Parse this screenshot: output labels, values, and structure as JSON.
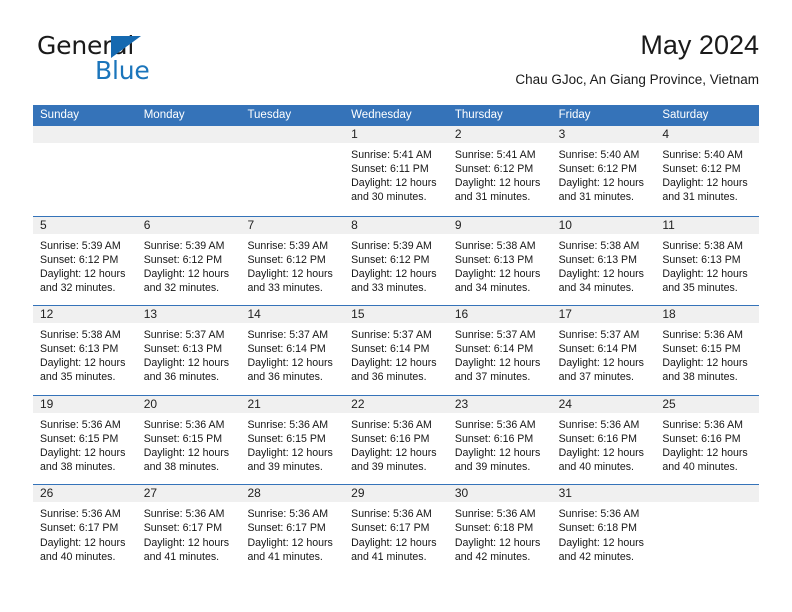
{
  "brand": {
    "name_top": "General",
    "name_bottom": "Blue",
    "accent_color": "#1b75bb",
    "triangle_color": "#1569b0"
  },
  "header": {
    "title": "May 2024",
    "subtitle": "Chau GJoc, An Giang Province, Vietnam"
  },
  "theme": {
    "header_band": "#3573b9",
    "day_band": "#f0f0f0",
    "text": "#161616"
  },
  "calendar": {
    "weekdays": [
      "Sunday",
      "Monday",
      "Tuesday",
      "Wednesday",
      "Thursday",
      "Friday",
      "Saturday"
    ],
    "weeks": [
      [
        {
          "day": "",
          "sunrise": "",
          "sunset": "",
          "daylight_line1": "",
          "daylight_line2": "",
          "empty": true
        },
        {
          "day": "",
          "sunrise": "",
          "sunset": "",
          "daylight_line1": "",
          "daylight_line2": "",
          "empty": true
        },
        {
          "day": "",
          "sunrise": "",
          "sunset": "",
          "daylight_line1": "",
          "daylight_line2": "",
          "empty": true
        },
        {
          "day": "1",
          "sunrise": "Sunrise: 5:41 AM",
          "sunset": "Sunset: 6:11 PM",
          "daylight_line1": "Daylight: 12 hours",
          "daylight_line2": "and 30 minutes."
        },
        {
          "day": "2",
          "sunrise": "Sunrise: 5:41 AM",
          "sunset": "Sunset: 6:12 PM",
          "daylight_line1": "Daylight: 12 hours",
          "daylight_line2": "and 31 minutes."
        },
        {
          "day": "3",
          "sunrise": "Sunrise: 5:40 AM",
          "sunset": "Sunset: 6:12 PM",
          "daylight_line1": "Daylight: 12 hours",
          "daylight_line2": "and 31 minutes."
        },
        {
          "day": "4",
          "sunrise": "Sunrise: 5:40 AM",
          "sunset": "Sunset: 6:12 PM",
          "daylight_line1": "Daylight: 12 hours",
          "daylight_line2": "and 31 minutes."
        }
      ],
      [
        {
          "day": "5",
          "sunrise": "Sunrise: 5:39 AM",
          "sunset": "Sunset: 6:12 PM",
          "daylight_line1": "Daylight: 12 hours",
          "daylight_line2": "and 32 minutes."
        },
        {
          "day": "6",
          "sunrise": "Sunrise: 5:39 AM",
          "sunset": "Sunset: 6:12 PM",
          "daylight_line1": "Daylight: 12 hours",
          "daylight_line2": "and 32 minutes."
        },
        {
          "day": "7",
          "sunrise": "Sunrise: 5:39 AM",
          "sunset": "Sunset: 6:12 PM",
          "daylight_line1": "Daylight: 12 hours",
          "daylight_line2": "and 33 minutes."
        },
        {
          "day": "8",
          "sunrise": "Sunrise: 5:39 AM",
          "sunset": "Sunset: 6:12 PM",
          "daylight_line1": "Daylight: 12 hours",
          "daylight_line2": "and 33 minutes."
        },
        {
          "day": "9",
          "sunrise": "Sunrise: 5:38 AM",
          "sunset": "Sunset: 6:13 PM",
          "daylight_line1": "Daylight: 12 hours",
          "daylight_line2": "and 34 minutes."
        },
        {
          "day": "10",
          "sunrise": "Sunrise: 5:38 AM",
          "sunset": "Sunset: 6:13 PM",
          "daylight_line1": "Daylight: 12 hours",
          "daylight_line2": "and 34 minutes."
        },
        {
          "day": "11",
          "sunrise": "Sunrise: 5:38 AM",
          "sunset": "Sunset: 6:13 PM",
          "daylight_line1": "Daylight: 12 hours",
          "daylight_line2": "and 35 minutes."
        }
      ],
      [
        {
          "day": "12",
          "sunrise": "Sunrise: 5:38 AM",
          "sunset": "Sunset: 6:13 PM",
          "daylight_line1": "Daylight: 12 hours",
          "daylight_line2": "and 35 minutes."
        },
        {
          "day": "13",
          "sunrise": "Sunrise: 5:37 AM",
          "sunset": "Sunset: 6:13 PM",
          "daylight_line1": "Daylight: 12 hours",
          "daylight_line2": "and 36 minutes."
        },
        {
          "day": "14",
          "sunrise": "Sunrise: 5:37 AM",
          "sunset": "Sunset: 6:14 PM",
          "daylight_line1": "Daylight: 12 hours",
          "daylight_line2": "and 36 minutes."
        },
        {
          "day": "15",
          "sunrise": "Sunrise: 5:37 AM",
          "sunset": "Sunset: 6:14 PM",
          "daylight_line1": "Daylight: 12 hours",
          "daylight_line2": "and 36 minutes."
        },
        {
          "day": "16",
          "sunrise": "Sunrise: 5:37 AM",
          "sunset": "Sunset: 6:14 PM",
          "daylight_line1": "Daylight: 12 hours",
          "daylight_line2": "and 37 minutes."
        },
        {
          "day": "17",
          "sunrise": "Sunrise: 5:37 AM",
          "sunset": "Sunset: 6:14 PM",
          "daylight_line1": "Daylight: 12 hours",
          "daylight_line2": "and 37 minutes."
        },
        {
          "day": "18",
          "sunrise": "Sunrise: 5:36 AM",
          "sunset": "Sunset: 6:15 PM",
          "daylight_line1": "Daylight: 12 hours",
          "daylight_line2": "and 38 minutes."
        }
      ],
      [
        {
          "day": "19",
          "sunrise": "Sunrise: 5:36 AM",
          "sunset": "Sunset: 6:15 PM",
          "daylight_line1": "Daylight: 12 hours",
          "daylight_line2": "and 38 minutes."
        },
        {
          "day": "20",
          "sunrise": "Sunrise: 5:36 AM",
          "sunset": "Sunset: 6:15 PM",
          "daylight_line1": "Daylight: 12 hours",
          "daylight_line2": "and 38 minutes."
        },
        {
          "day": "21",
          "sunrise": "Sunrise: 5:36 AM",
          "sunset": "Sunset: 6:15 PM",
          "daylight_line1": "Daylight: 12 hours",
          "daylight_line2": "and 39 minutes."
        },
        {
          "day": "22",
          "sunrise": "Sunrise: 5:36 AM",
          "sunset": "Sunset: 6:16 PM",
          "daylight_line1": "Daylight: 12 hours",
          "daylight_line2": "and 39 minutes."
        },
        {
          "day": "23",
          "sunrise": "Sunrise: 5:36 AM",
          "sunset": "Sunset: 6:16 PM",
          "daylight_line1": "Daylight: 12 hours",
          "daylight_line2": "and 39 minutes."
        },
        {
          "day": "24",
          "sunrise": "Sunrise: 5:36 AM",
          "sunset": "Sunset: 6:16 PM",
          "daylight_line1": "Daylight: 12 hours",
          "daylight_line2": "and 40 minutes."
        },
        {
          "day": "25",
          "sunrise": "Sunrise: 5:36 AM",
          "sunset": "Sunset: 6:16 PM",
          "daylight_line1": "Daylight: 12 hours",
          "daylight_line2": "and 40 minutes."
        }
      ],
      [
        {
          "day": "26",
          "sunrise": "Sunrise: 5:36 AM",
          "sunset": "Sunset: 6:17 PM",
          "daylight_line1": "Daylight: 12 hours",
          "daylight_line2": "and 40 minutes."
        },
        {
          "day": "27",
          "sunrise": "Sunrise: 5:36 AM",
          "sunset": "Sunset: 6:17 PM",
          "daylight_line1": "Daylight: 12 hours",
          "daylight_line2": "and 41 minutes."
        },
        {
          "day": "28",
          "sunrise": "Sunrise: 5:36 AM",
          "sunset": "Sunset: 6:17 PM",
          "daylight_line1": "Daylight: 12 hours",
          "daylight_line2": "and 41 minutes."
        },
        {
          "day": "29",
          "sunrise": "Sunrise: 5:36 AM",
          "sunset": "Sunset: 6:17 PM",
          "daylight_line1": "Daylight: 12 hours",
          "daylight_line2": "and 41 minutes."
        },
        {
          "day": "30",
          "sunrise": "Sunrise: 5:36 AM",
          "sunset": "Sunset: 6:18 PM",
          "daylight_line1": "Daylight: 12 hours",
          "daylight_line2": "and 42 minutes."
        },
        {
          "day": "31",
          "sunrise": "Sunrise: 5:36 AM",
          "sunset": "Sunset: 6:18 PM",
          "daylight_line1": "Daylight: 12 hours",
          "daylight_line2": "and 42 minutes."
        },
        {
          "day": "",
          "sunrise": "",
          "sunset": "",
          "daylight_line1": "",
          "daylight_line2": "",
          "empty": true
        }
      ]
    ]
  }
}
